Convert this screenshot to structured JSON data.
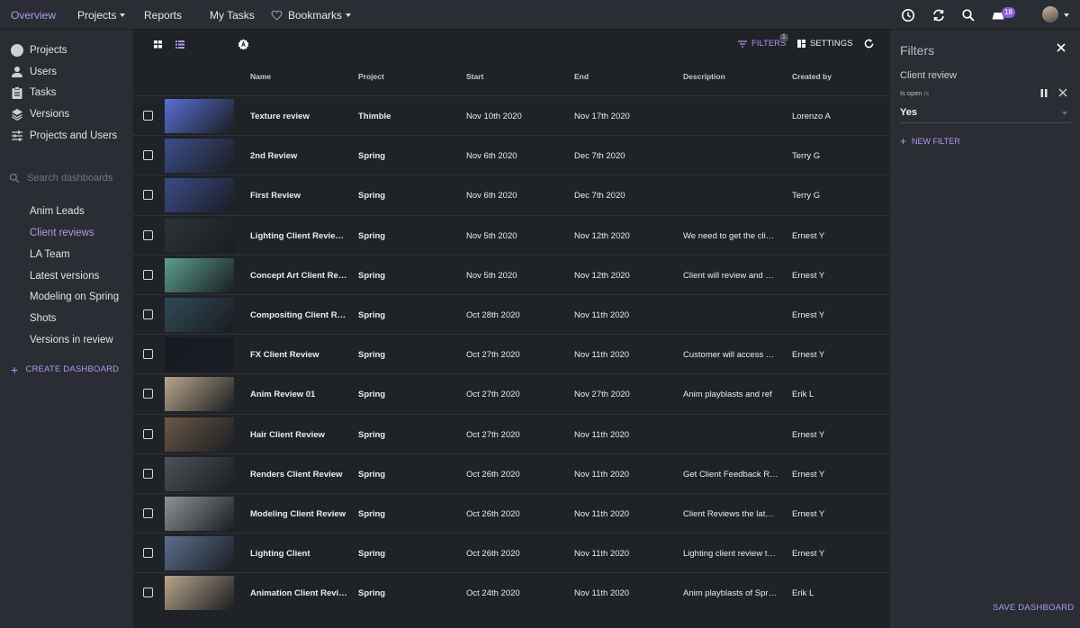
{
  "nav": {
    "overview": "Overview",
    "projects": "Projects",
    "reports": "Reports",
    "my_tasks": "My Tasks",
    "bookmarks": "Bookmarks",
    "inbox_count": "18",
    "active_color": "#b596f2"
  },
  "sidebar": {
    "items": [
      {
        "label": "Projects",
        "icon": "circle-icon"
      },
      {
        "label": "Users",
        "icon": "user-icon"
      },
      {
        "label": "Tasks",
        "icon": "clipboard-icon"
      },
      {
        "label": "Versions",
        "icon": "layers-icon"
      },
      {
        "label": "Projects and Users",
        "icon": "sliders-icon"
      }
    ],
    "search_placeholder": "Search dashboards",
    "dashboards": [
      {
        "label": "Anim Leads"
      },
      {
        "label": "Client reviews",
        "active": true
      },
      {
        "label": "LA Team"
      },
      {
        "label": "Latest versions"
      },
      {
        "label": "Modeling on Spring"
      },
      {
        "label": "Shots"
      },
      {
        "label": "Versions in review"
      }
    ],
    "create_dashboard": "CREATE DASHBOARD"
  },
  "toolbar": {
    "filters_label": "FILTERS",
    "filters_count": "1",
    "settings_label": "SETTINGS"
  },
  "table": {
    "columns": [
      "Name",
      "Project",
      "Start",
      "End",
      "Description",
      "Created by"
    ],
    "rows": [
      {
        "name": "Texture review",
        "project": "Thimble",
        "start": "Nov 10th 2020",
        "end": "Nov 17th 2020",
        "description": "",
        "created_by": "Lorenzo A",
        "thumb": "#5a6fd6"
      },
      {
        "name": "2nd Review",
        "project": "Spring",
        "start": "Nov 6th 2020",
        "end": "Dec 7th 2020",
        "description": "",
        "created_by": "Terry G",
        "thumb": "#3d4f8a"
      },
      {
        "name": "First Review",
        "project": "Spring",
        "start": "Nov 6th 2020",
        "end": "Dec 7th 2020",
        "description": "",
        "created_by": "Terry G",
        "thumb": "#3a4c88"
      },
      {
        "name": "Lighting Client Review for...",
        "project": "Spring",
        "start": "Nov 5th 2020",
        "end": "Nov 12th 2020",
        "description": "We need to get the client...",
        "created_by": "Ernest Y",
        "thumb": "#2c3438"
      },
      {
        "name": "Concept Art Client Review",
        "project": "Spring",
        "start": "Nov 5th 2020",
        "end": "Nov 12th 2020",
        "description": "Client will review and approve",
        "created_by": "Ernest Y",
        "thumb": "#5b9f8c"
      },
      {
        "name": "Compositing Client Review",
        "project": "Spring",
        "start": "Oct 28th 2020",
        "end": "Nov 11th 2020",
        "description": "",
        "created_by": "Ernest Y",
        "thumb": "#2f4a55"
      },
      {
        "name": "FX Client Review",
        "project": "Spring",
        "start": "Oct 27th 2020",
        "end": "Nov 11th 2020",
        "description": "Customer will access and...",
        "created_by": "Ernest Y",
        "thumb": "#151a22"
      },
      {
        "name": "Anim Review 01",
        "project": "Spring",
        "start": "Oct 27th 2020",
        "end": "Nov 27th 2020",
        "description": "Anim playblasts and ref",
        "created_by": "Erik L",
        "thumb": "#b9a58a"
      },
      {
        "name": "Hair Client Review",
        "project": "Spring",
        "start": "Oct 27th 2020",
        "end": "Nov 11th 2020",
        "description": "",
        "created_by": "Ernest Y",
        "thumb": "#6c5846"
      },
      {
        "name": "Renders Client Review",
        "project": "Spring",
        "start": "Oct 26th 2020",
        "end": "Nov 11th 2020",
        "description": "Get Client Feedback Renders",
        "created_by": "Ernest Y",
        "thumb": "#4d5258"
      },
      {
        "name": "Modeling Client Review",
        "project": "Spring",
        "start": "Oct 26th 2020",
        "end": "Nov 11th 2020",
        "description": "Client Reviews the latest...",
        "created_by": "Ernest Y",
        "thumb": "#8e9196"
      },
      {
        "name": "Lighting Client",
        "project": "Spring",
        "start": "Oct 26th 2020",
        "end": "Nov 11th 2020",
        "description": "Lighting client review this...",
        "created_by": "Ernest Y",
        "thumb": "#5d6f8e"
      },
      {
        "name": "Animation Client Review",
        "project": "Spring",
        "start": "Oct 24th 2020",
        "end": "Nov 11th 2020",
        "description": "Anim playblasts of Spring",
        "created_by": "Erik L",
        "thumb": "#b9a58a"
      }
    ]
  },
  "filters_panel": {
    "title": "Filters",
    "subject": "Client review",
    "condition_field": "Is open",
    "condition_op": "is",
    "value": "Yes",
    "new_filter": "NEW FILTER",
    "save_dashboard": "SAVE DASHBOARD"
  }
}
